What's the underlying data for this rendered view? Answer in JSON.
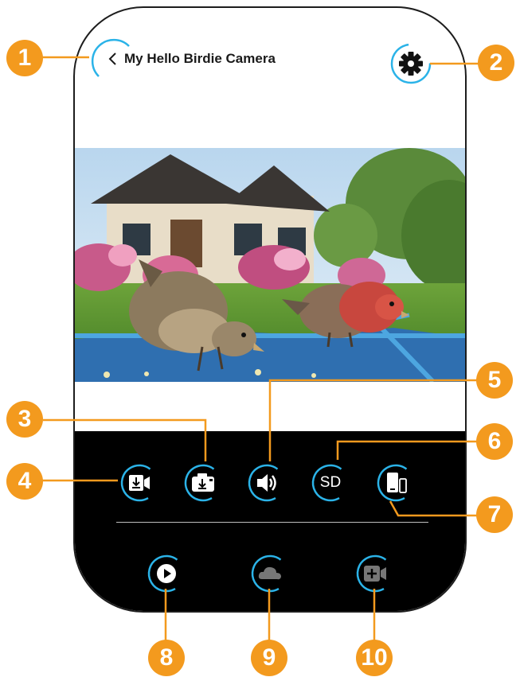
{
  "header": {
    "back_icon": "chevron-left-icon",
    "title": "My Hello Birdie Camera",
    "settings_icon": "gear-icon"
  },
  "video_feed": {
    "content": "live-camera-feed"
  },
  "controls": {
    "row1": [
      {
        "id": "record-video",
        "icon": "video-download-icon"
      },
      {
        "id": "snapshot",
        "icon": "camera-download-icon"
      },
      {
        "id": "sound",
        "icon": "speaker-icon"
      },
      {
        "id": "quality",
        "label": "SD"
      },
      {
        "id": "orientation",
        "icon": "phone-rotate-icon"
      }
    ],
    "row2": [
      {
        "id": "playback",
        "icon": "play-icon"
      },
      {
        "id": "cloud",
        "icon": "cloud-icon"
      },
      {
        "id": "add-camera",
        "icon": "video-add-icon"
      }
    ]
  },
  "callouts": [
    "1",
    "2",
    "3",
    "4",
    "5",
    "6",
    "7",
    "8",
    "9",
    "10"
  ],
  "colors": {
    "accent_blue": "#2bb3e8",
    "badge_orange": "#f39a1e",
    "bar_black": "#000000"
  }
}
